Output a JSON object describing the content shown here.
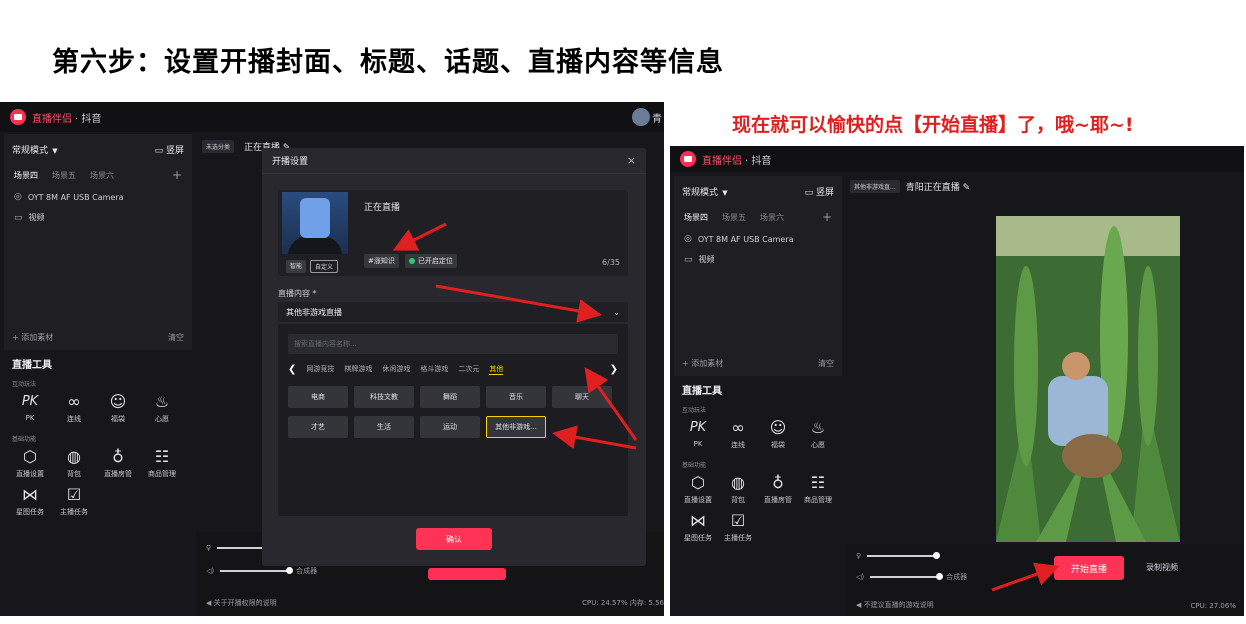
{
  "heading": "第六步：设置开播封面、标题、话题、直播内容等信息",
  "caption": "现在就可以愉快的点【开始直播】了，哦~耶~!",
  "app": {
    "name": "直播伴侣",
    "suffix": "· 抖音",
    "user": "青"
  },
  "sidebar": {
    "mode": "常规模式",
    "screen_btn": "竖屏",
    "scenes": [
      "场景四",
      "场景五",
      "场景六"
    ],
    "sources": [
      "OYT 8M AF USB Camera",
      "视频"
    ],
    "add_source": "+ 添加素材",
    "clear": "清空",
    "tools_title": "直播工具",
    "group_interactive": "互动玩法",
    "interactive": [
      {
        "glyph": "PK",
        "label": "PK"
      },
      {
        "glyph": "∞",
        "label": "连线"
      },
      {
        "glyph": "☺",
        "label": "福袋"
      },
      {
        "glyph": "♨",
        "label": "心愿"
      }
    ],
    "group_basic": "基础功能",
    "basic": [
      {
        "glyph": "⬡",
        "label": "直播设置"
      },
      {
        "glyph": "◍",
        "label": "背包"
      },
      {
        "glyph": "♁",
        "label": "直播房管"
      },
      {
        "glyph": "☷",
        "label": "商品管理"
      },
      {
        "glyph": "⋈",
        "label": "星图任务"
      },
      {
        "glyph": "☑",
        "label": "主播任务"
      }
    ]
  },
  "left_main": {
    "category_chip": "未选分类",
    "live_title": "正在直播 ✎",
    "mixer_label": "合成器",
    "notice": "关于开播权限的说明",
    "stats": "CPU: 24.57%  内存: 5.56"
  },
  "modal": {
    "title": "开播设置",
    "close": "×",
    "cover_btn_smart": "智能",
    "cover_btn_custom": "自定义",
    "title_value": "正在直播",
    "topic_tag": "#涨知识",
    "location_tag": "已开启定位",
    "counter": "6/35",
    "content_label": "直播内容 *",
    "content_value": "其他非游戏直播",
    "search_placeholder": "搜索直播内容名称...",
    "categories": [
      "网游竞技",
      "棋牌游戏",
      "休闲游戏",
      "格斗游戏",
      "二次元",
      "其他"
    ],
    "options": [
      "电商",
      "科技文教",
      "舞蹈",
      "音乐",
      "聊天",
      "才艺",
      "生活",
      "运动",
      "其他非游戏..."
    ],
    "confirm": "确认"
  },
  "right": {
    "category_chip": "其他非游戏直...",
    "live_title": "青阳正在直播 ✎",
    "start_btn": "开始直播",
    "record_btn": "录制视频",
    "mixer_label": "合成器",
    "notice": "不建议直播的游戏说明",
    "cpu": "CPU: 27.06%"
  },
  "colors": {
    "accent": "#ff3355",
    "arrow": "#e02020",
    "selected": "#f5d300"
  }
}
